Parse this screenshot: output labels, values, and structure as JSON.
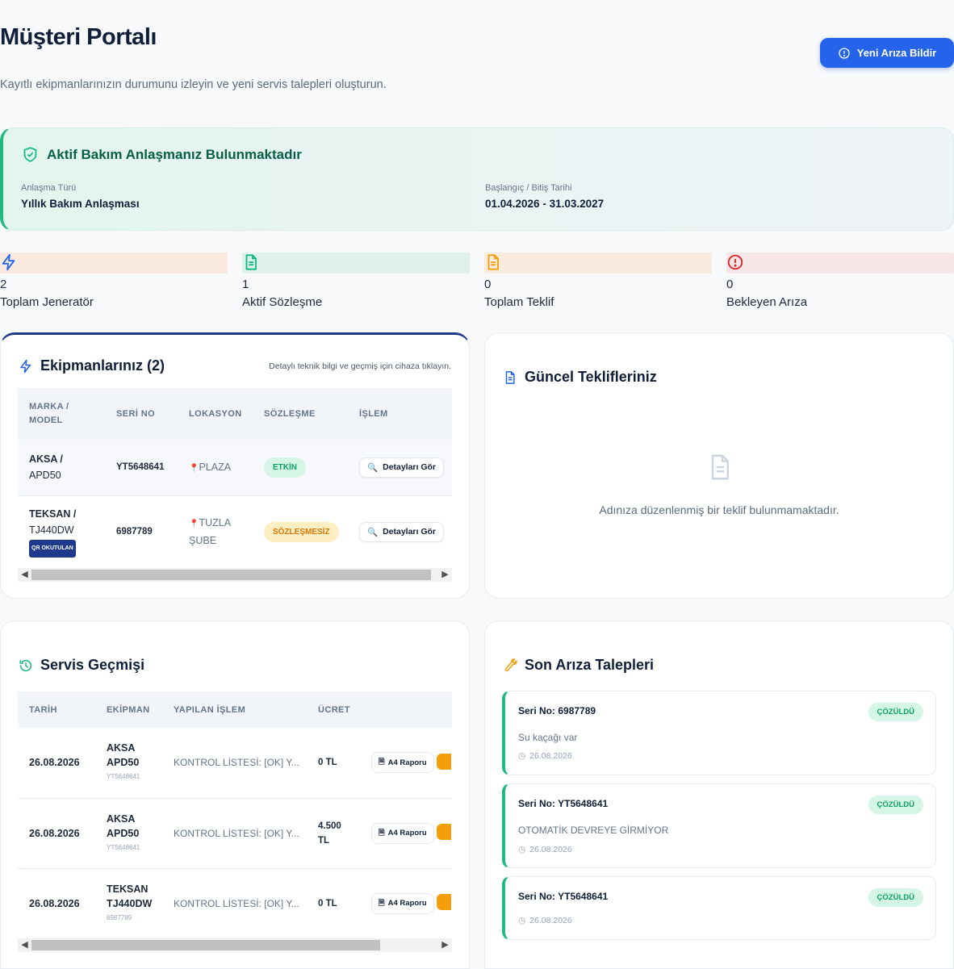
{
  "header": {
    "title": "Müşteri Portalı",
    "subtitle": "Kayıtlı ekipmanlarınızın durumunu izleyin ve yeni servis talepleri oluşturun.",
    "report_button": "Yeni Arıza Bildir"
  },
  "agreement": {
    "title": "Aktif Bakım Anlaşmanız Bulunmaktadır",
    "type_label": "Anlaşma Türü",
    "type_value": "Yıllık Bakım Anlaşması",
    "date_label": "Başlangıç / Bitiş Tarihi",
    "date_value": "01.04.2026 - 31.03.2027"
  },
  "stats": [
    {
      "value": "2",
      "label": "Toplam Jeneratör",
      "icon": "bolt-icon",
      "color": "#2563eb",
      "bg": "#f9e9df"
    },
    {
      "value": "1",
      "label": "Aktif Sözleşme",
      "icon": "document-icon",
      "color": "#10b981",
      "bg": "#e0f1ec"
    },
    {
      "value": "0",
      "label": "Toplam Teklif",
      "icon": "document-icon",
      "color": "#f59e0b",
      "bg": "#f9ecdf"
    },
    {
      "value": "0",
      "label": "Bekleyen Arıza",
      "icon": "alert-circle-icon",
      "color": "#dc2626",
      "bg": "#f7e6e7"
    }
  ],
  "equipment": {
    "title": "Ekipmanlarınız (2)",
    "hint": "Detaylı teknik bilgi ve geçmiş için cihaza tıklayın.",
    "columns": [
      "MARKA / MODEL",
      "SERİ NO",
      "LOKASYON",
      "SÖZLEŞME",
      "İŞLEM"
    ],
    "rows": [
      {
        "brand": "AKSA /",
        "model": "APD50",
        "serial": "YT5648641",
        "location": "PLAZA",
        "contract": "ETKİN",
        "action": "Detayları Gör"
      },
      {
        "brand": "TEKSAN /",
        "model": "TJ440DW",
        "qr": "QR OKUTULAN",
        "serial": "6987789",
        "location": "TUZLA ŞUBE",
        "contract": "SÖZLEŞMESİZ",
        "action": "Detayları Gör"
      }
    ]
  },
  "offers": {
    "title": "Güncel Teklifleriniz",
    "empty_text": "Adınıza düzenlenmiş bir teklif bulunmamaktadır."
  },
  "service_history": {
    "title": "Servis Geçmişi",
    "columns": [
      "TARİH",
      "EKİPMAN",
      "YAPILAN İŞLEM",
      "ÜCRET"
    ],
    "rows": [
      {
        "date": "26.08.2026",
        "brand": "AKSA",
        "model": "APD50",
        "serial": "YT5648641",
        "work": "KONTROL LİSTESİ: [OK] Y...",
        "price": "0 TL",
        "report": "A4 Raporu"
      },
      {
        "date": "26.08.2026",
        "brand": "AKSA",
        "model": "APD50",
        "serial": "YT5648641",
        "work": "KONTROL LİSTESİ: [OK] Y...",
        "price": "4.500 TL",
        "report": "A4 Raporu"
      },
      {
        "date": "26.08.2026",
        "brand": "TEKSAN",
        "model": "TJ440DW",
        "serial": "6987789",
        "work": "KONTROL LİSTESİ: [OK] Y...",
        "price": "0 TL",
        "report": "A4 Raporu"
      }
    ]
  },
  "faults": {
    "title": "Son Arıza Talepleri",
    "items": [
      {
        "serial": "Seri No: 6987789",
        "desc": "Su kaçağı var",
        "date": "26.08.2026",
        "status": "ÇÖZÜLDÜ"
      },
      {
        "serial": "Seri No: YT5648641",
        "desc": "OTOMATİK DEVREYE GİRMİYOR",
        "date": "26.08.2026",
        "status": "ÇÖZÜLDÜ"
      },
      {
        "serial": "Seri No: YT5648641",
        "desc": "",
        "date": "26.08.2026",
        "status": "ÇÖZÜLDÜ"
      }
    ]
  }
}
